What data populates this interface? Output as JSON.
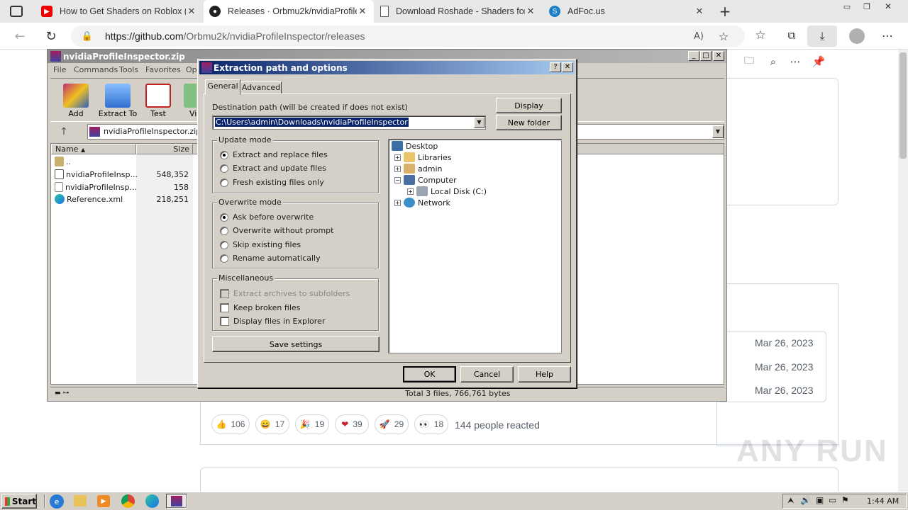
{
  "browser": {
    "tabs": [
      {
        "title": "How to Get Shaders on Roblox (F",
        "icon": "youtube-icon"
      },
      {
        "title": "Releases · Orbmu2k/nvidiaProfile",
        "icon": "github-icon"
      },
      {
        "title": "Download Roshade - Shaders for",
        "icon": "page-icon"
      },
      {
        "title": "AdFoc.us",
        "icon": "adfocus-icon"
      }
    ],
    "url_host": "https://github.com",
    "url_path": "/Orbmu2k/nvidiaProfileInspector/releases"
  },
  "page": {
    "dates": [
      "Mar 26, 2023",
      "Mar 26, 2023",
      "Mar 26, 2023"
    ],
    "reactions": [
      {
        "emoji": "👍",
        "count": "106"
      },
      {
        "emoji": "😄",
        "count": "17"
      },
      {
        "emoji": "🎉",
        "count": "19"
      },
      {
        "emoji": "❤",
        "count": "39"
      },
      {
        "emoji": "🚀",
        "count": "29"
      },
      {
        "emoji": "👀",
        "count": "18"
      }
    ],
    "reacted_text": "144 people reacted"
  },
  "winrar": {
    "title": "nvidiaProfileInspector.zip",
    "menu": [
      "File",
      "Commands",
      "Tools",
      "Favorites",
      "Opt"
    ],
    "toolbar": [
      "Add",
      "Extract To",
      "Test",
      "Vi"
    ],
    "path": "nvidiaProfileInspector.zip -",
    "columns": {
      "name": "Name",
      "size": "Size"
    },
    "files": [
      {
        "name": "..",
        "size": ""
      },
      {
        "name": "nvidiaProfileInsp...",
        "size": "548,352"
      },
      {
        "name": "nvidiaProfileInsp...",
        "size": "158"
      },
      {
        "name": "Reference.xml",
        "size": "218,251"
      }
    ],
    "status": "Total 3 files, 766,761 bytes"
  },
  "dialog": {
    "title": "Extraction path and options",
    "tabs": [
      "General",
      "Advanced"
    ],
    "dest_label": "Destination path (will be created if does not exist)",
    "dest_value": "C:\\Users\\admin\\Downloads\\nvidiaProfileInspector",
    "display_btn": "Display",
    "newfolder_btn": "New folder",
    "update_mode": {
      "caption": "Update mode",
      "options": [
        "Extract and replace files",
        "Extract and update files",
        "Fresh existing files only"
      ],
      "selected": 0
    },
    "overwrite_mode": {
      "caption": "Overwrite mode",
      "options": [
        "Ask before overwrite",
        "Overwrite without prompt",
        "Skip existing files",
        "Rename automatically"
      ],
      "selected": 0
    },
    "misc": {
      "caption": "Miscellaneous",
      "options": [
        "Extract archives to subfolders",
        "Keep broken files",
        "Display files in Explorer"
      ]
    },
    "save_btn": "Save settings",
    "tree": [
      "Desktop",
      "Libraries",
      "admin",
      "Computer",
      "Local Disk (C:)",
      "Network"
    ],
    "ok": "OK",
    "cancel": "Cancel",
    "help": "Help"
  },
  "taskbar": {
    "start": "Start",
    "time": "1:44 AM"
  },
  "watermark": "ANY RUN"
}
